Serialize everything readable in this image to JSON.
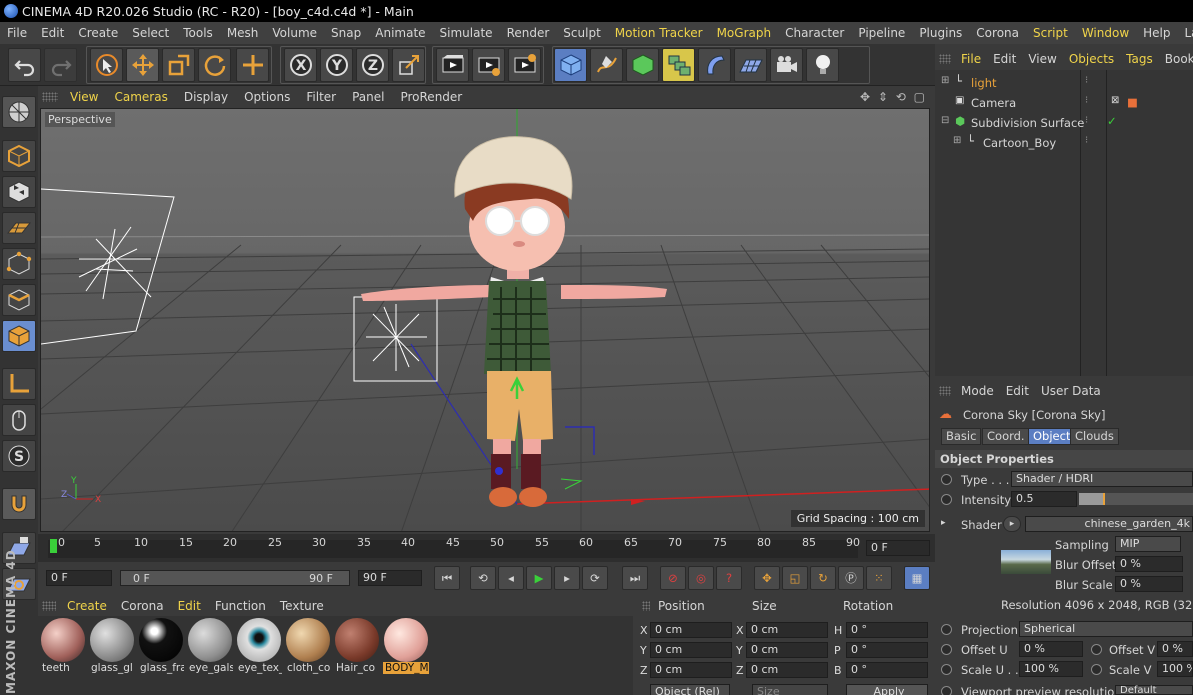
{
  "window": {
    "title": "CINEMA 4D R20.026 Studio (RC - R20) - [boy_c4d.c4d *] - Main"
  },
  "menubar": {
    "items": [
      "File",
      "Edit",
      "Create",
      "Select",
      "Tools",
      "Mesh",
      "Volume",
      "Snap",
      "Animate",
      "Simulate",
      "Render",
      "Sculpt",
      "Motion Tracker",
      "MoGraph",
      "Character",
      "Pipeline",
      "Plugins",
      "Corona",
      "Script",
      "Window",
      "Help"
    ],
    "right": "Layo"
  },
  "viewport": {
    "menu": [
      "View",
      "Cameras",
      "Display",
      "Options",
      "Filter",
      "Panel",
      "ProRender"
    ],
    "label": "Perspective",
    "grid_spacing": "Grid Spacing : 100 cm",
    "axis_labels": {
      "y": "Y",
      "z": "Z",
      "x": "X"
    }
  },
  "timeline": {
    "ticks": [
      "0",
      "5",
      "10",
      "15",
      "20",
      "25",
      "30",
      "35",
      "40",
      "45",
      "50",
      "55",
      "60",
      "65",
      "70",
      "75",
      "80",
      "85",
      "90"
    ],
    "current_frame": "0 F",
    "start_field": "0 F",
    "range_start": "0 F",
    "range_end": "90 F",
    "end_field": "90 F"
  },
  "materials": {
    "menu": [
      "Create",
      "Corona",
      "Edit",
      "Function",
      "Texture"
    ],
    "items": [
      {
        "name": "teeth"
      },
      {
        "name": "glass_gl"
      },
      {
        "name": "glass_fra"
      },
      {
        "name": "eye_gals"
      },
      {
        "name": "eye_tex_"
      },
      {
        "name": "cloth_co"
      },
      {
        "name": "Hair_co"
      },
      {
        "name": "BODY_M"
      }
    ]
  },
  "coordinates": {
    "headers": [
      "Position",
      "Size",
      "Rotation"
    ],
    "rows": [
      {
        "a": "X",
        "av": "0 cm",
        "b": "X",
        "bv": "0 cm",
        "c": "H",
        "cv": "0 °"
      },
      {
        "a": "Y",
        "av": "0 cm",
        "b": "Y",
        "bv": "0 cm",
        "c": "P",
        "cv": "0 °"
      },
      {
        "a": "Z",
        "av": "0 cm",
        "b": "Z",
        "bv": "0 cm",
        "c": "B",
        "cv": "0 °"
      }
    ],
    "mode": "Object (Rel)",
    "size_mode": "Size",
    "apply": "Apply"
  },
  "object_manager": {
    "menu": [
      "File",
      "Edit",
      "View",
      "Objects",
      "Tags",
      "Bookm"
    ],
    "objects": [
      {
        "name": "light"
      },
      {
        "name": "Camera"
      },
      {
        "name": "Subdivision Surface"
      },
      {
        "name": "Cartoon_Boy"
      }
    ]
  },
  "attribute_manager": {
    "menu": [
      "Mode",
      "Edit",
      "User Data"
    ],
    "object_title": "Corona Sky [Corona Sky]",
    "tabs": [
      "Basic",
      "Coord.",
      "Object",
      "Clouds"
    ],
    "active_tab": "Object",
    "section": "Object Properties",
    "type_label": "Type . . .",
    "type_value": "Shader / HDRI",
    "intensity_label": "Intensity",
    "intensity_value": "0.5",
    "shader_label": "Shader",
    "shader_value": "chinese_garden_4k",
    "sampling_label": "Sampling",
    "sampling_value": "MIP",
    "blur_offset_label": "Blur Offset",
    "blur_offset_value": "0 %",
    "blur_scale_label": "Blur Scale",
    "blur_scale_value": "0 %",
    "resolution": "Resolution 4096 x 2048, RGB (32 Bit), L",
    "projection_label": "Projection",
    "projection_value": "Spherical",
    "offset_u_label": "Offset U",
    "offset_u_value": "0 %",
    "offset_v_label": "Offset V",
    "offset_v_value": "0 %",
    "scale_u_label": "Scale U . .",
    "scale_u_value": "100 %",
    "scale_v_label": "Scale V",
    "scale_v_value": "100 %",
    "viewport_preview": "Viewport preview resolution",
    "viewport_preview_value": "Default"
  },
  "branding": {
    "vertical_text": "MAXON CINEMA 4D"
  },
  "colors": {
    "accent_yellow": "#f0d44a",
    "selection_blue": "#5b7ec2",
    "active_orange": "#e8a23a"
  }
}
